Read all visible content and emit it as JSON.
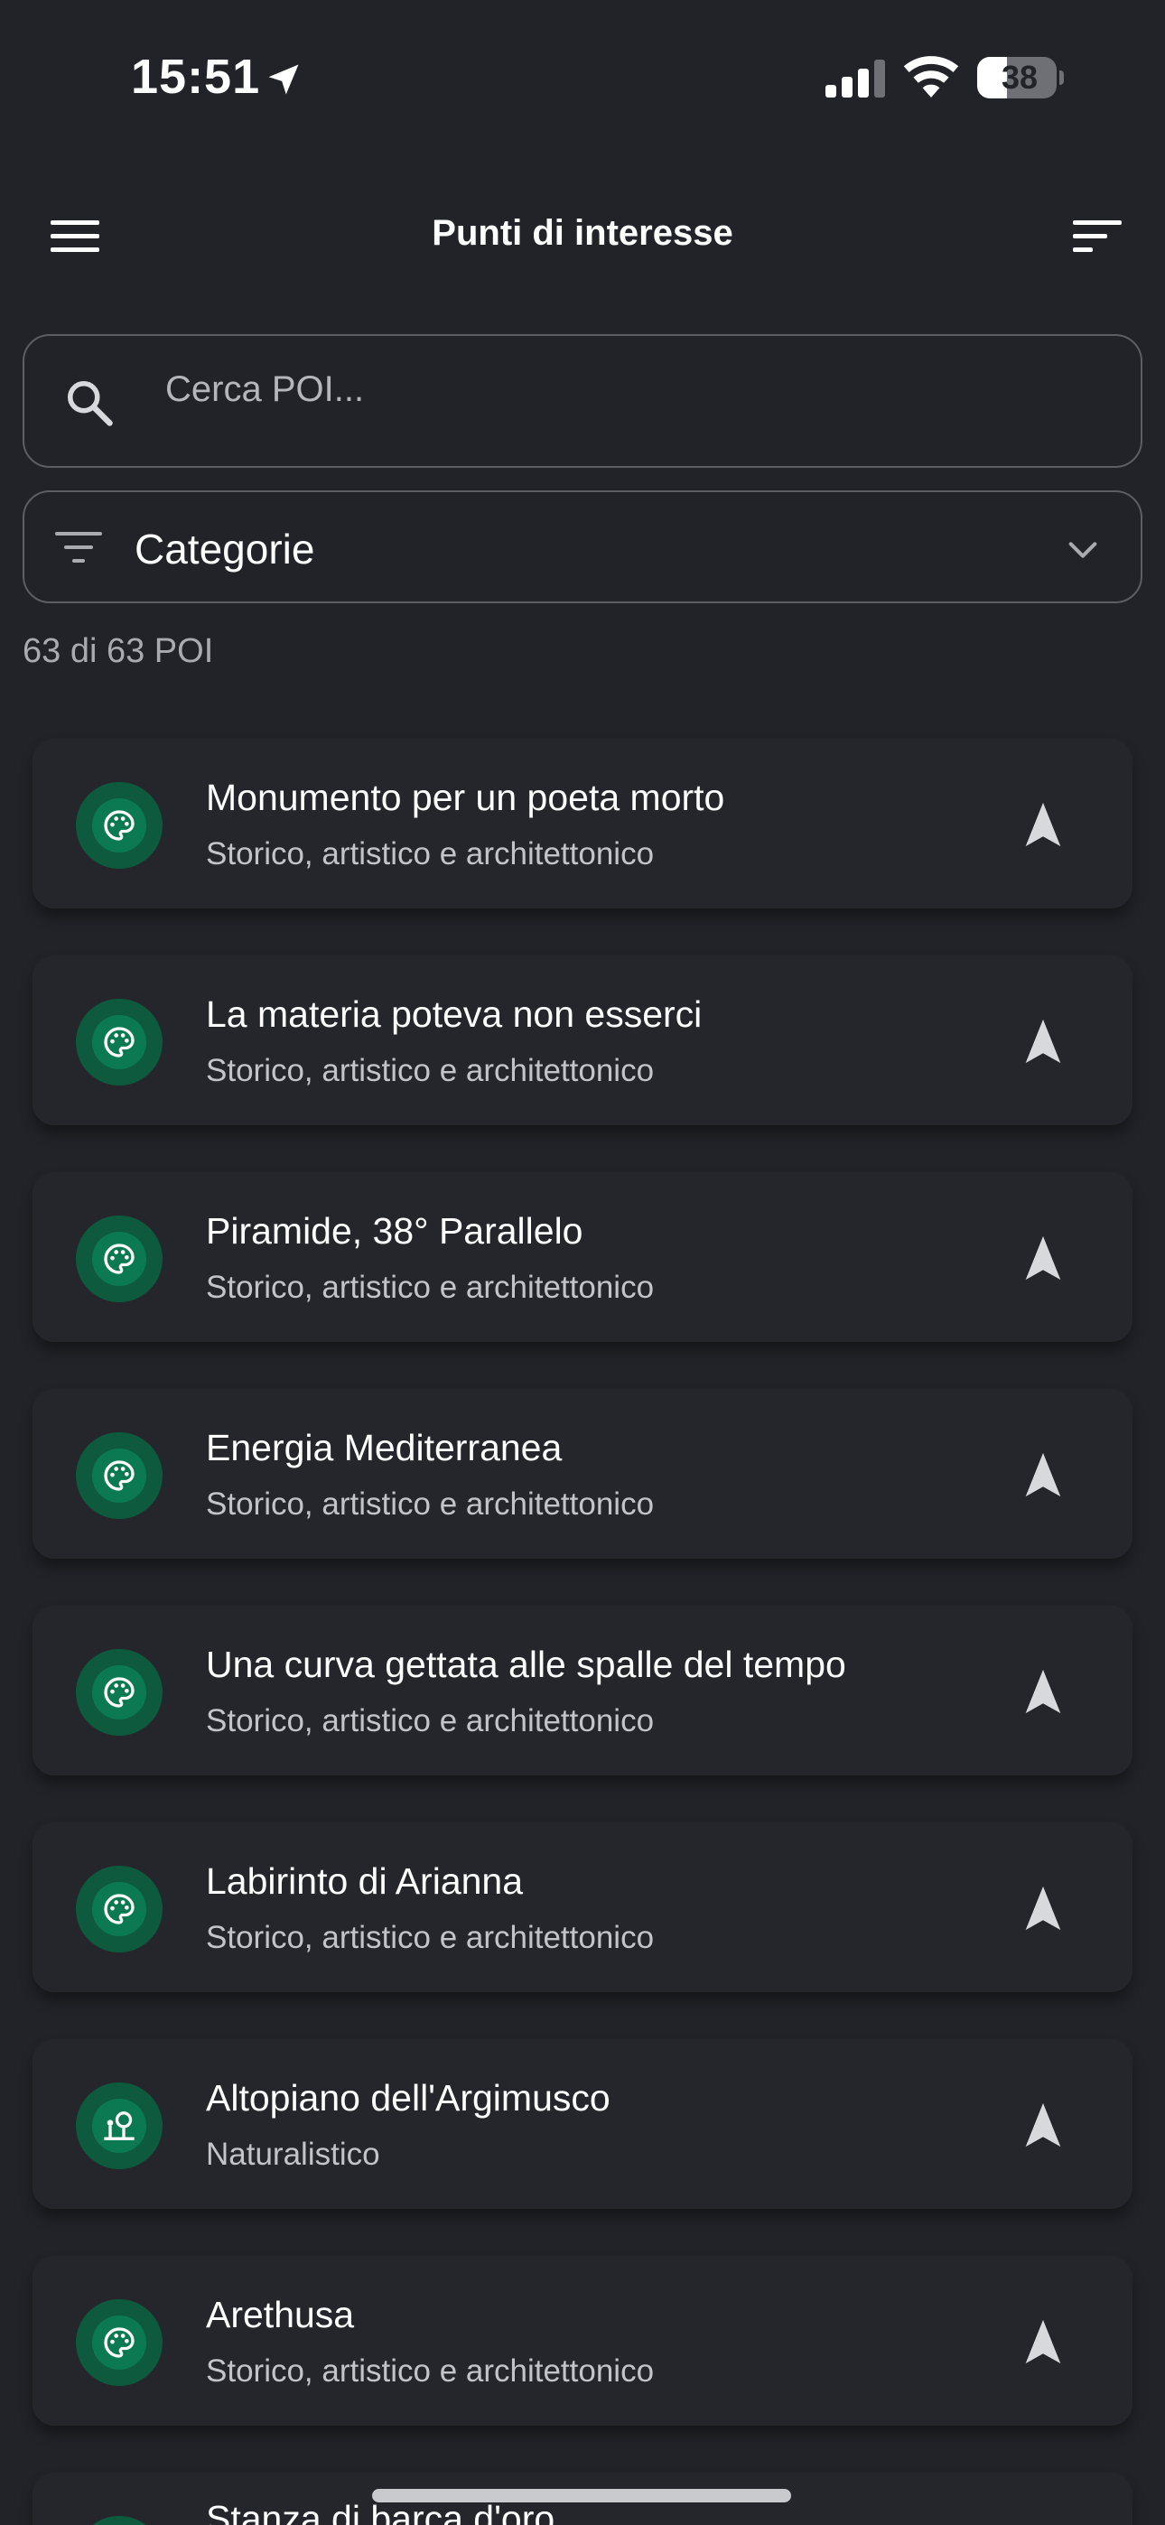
{
  "status_bar": {
    "time": "15:51",
    "battery": "38",
    "battery_level": 0.38
  },
  "app_bar": {
    "title": "Punti di interesse"
  },
  "search": {
    "placeholder": "Cerca POI..."
  },
  "categories": {
    "label": "Categorie"
  },
  "count_text": "63 di 63 POI",
  "colors": {
    "background": "#212328",
    "card": "#24262b",
    "avatar_outer": "#0e5a3e",
    "avatar_inner": "#0b7a52",
    "muted_text": "#a9abb0"
  },
  "pois": [
    {
      "name": "Monumento per un poeta morto",
      "category": "Storico, artistico e architettonico",
      "icon": "palette-icon"
    },
    {
      "name": "La materia poteva non esserci",
      "category": "Storico, artistico e architettonico",
      "icon": "palette-icon"
    },
    {
      "name": "Piramide, 38° Parallelo",
      "category": "Storico, artistico e architettonico",
      "icon": "palette-icon"
    },
    {
      "name": "Energia Mediterranea",
      "category": "Storico, artistico e architettonico",
      "icon": "palette-icon"
    },
    {
      "name": "Una curva gettata alle spalle del tempo",
      "category": "Storico, artistico e architettonico",
      "icon": "palette-icon"
    },
    {
      "name": "Labirinto di Arianna",
      "category": "Storico, artistico e architettonico",
      "icon": "palette-icon"
    },
    {
      "name": "Altopiano dell'Argimusco",
      "category": "Naturalistico",
      "icon": "nature-icon"
    },
    {
      "name": "Arethusa",
      "category": "Storico, artistico e architettonico",
      "icon": "palette-icon"
    },
    {
      "name": "Stanza di barca d'oro",
      "category": "",
      "icon": "palette-icon"
    }
  ]
}
